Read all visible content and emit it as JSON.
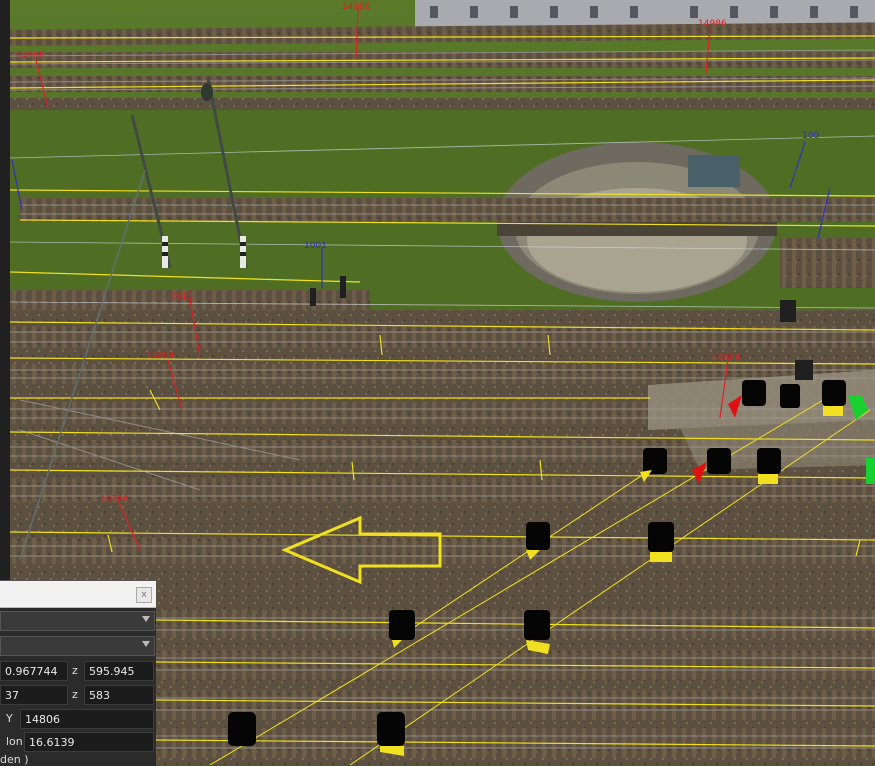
{
  "scene": {
    "distance_labels": [
      "14986",
      "14986",
      "14986",
      "7013",
      "14804",
      "14804",
      "10788",
      "1001",
      "100"
    ],
    "colors": {
      "marker_yellow": "#f0e020",
      "signal_red": "#e01010",
      "signal_green": "#18d030",
      "label_red": "#e02020",
      "label_blue": "#3030c0"
    }
  },
  "panel": {
    "close_glyph": "x",
    "row1": {
      "value": "0.967744",
      "z_label": "z",
      "z_value": "595.945"
    },
    "row2": {
      "value": "37",
      "z_label": "z",
      "z_value": "583"
    },
    "row3": {
      "y_label": "Y",
      "y_value": "14806"
    },
    "row4": {
      "lon_label": "lon",
      "lon_value": "16.6139"
    },
    "status": "den )"
  }
}
